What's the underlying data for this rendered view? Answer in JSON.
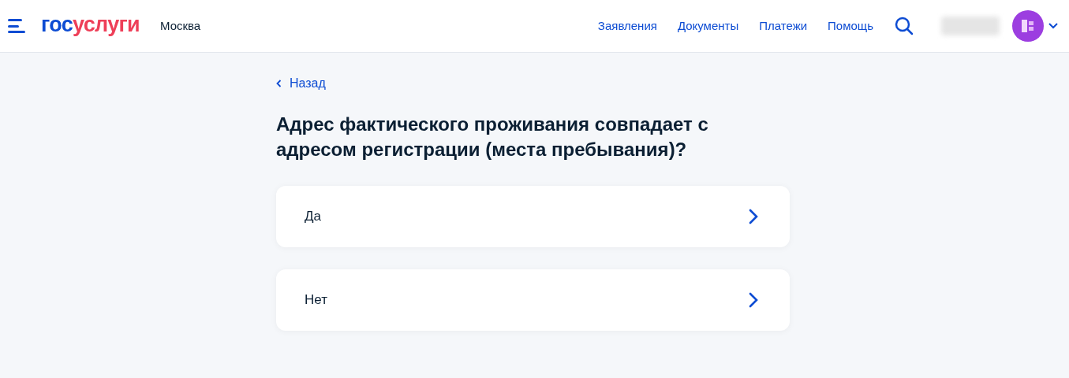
{
  "header": {
    "logo": {
      "prefix": "гос",
      "suffix": "услуги"
    },
    "city": "Москва",
    "nav": [
      "Заявления",
      "Документы",
      "Платежи",
      "Помощь"
    ]
  },
  "back": "Назад",
  "question": "Адрес фактического проживания совпадает с адресом регистрации (места пребывания)?",
  "options": [
    {
      "label": "Да"
    },
    {
      "label": "Нет"
    }
  ]
}
